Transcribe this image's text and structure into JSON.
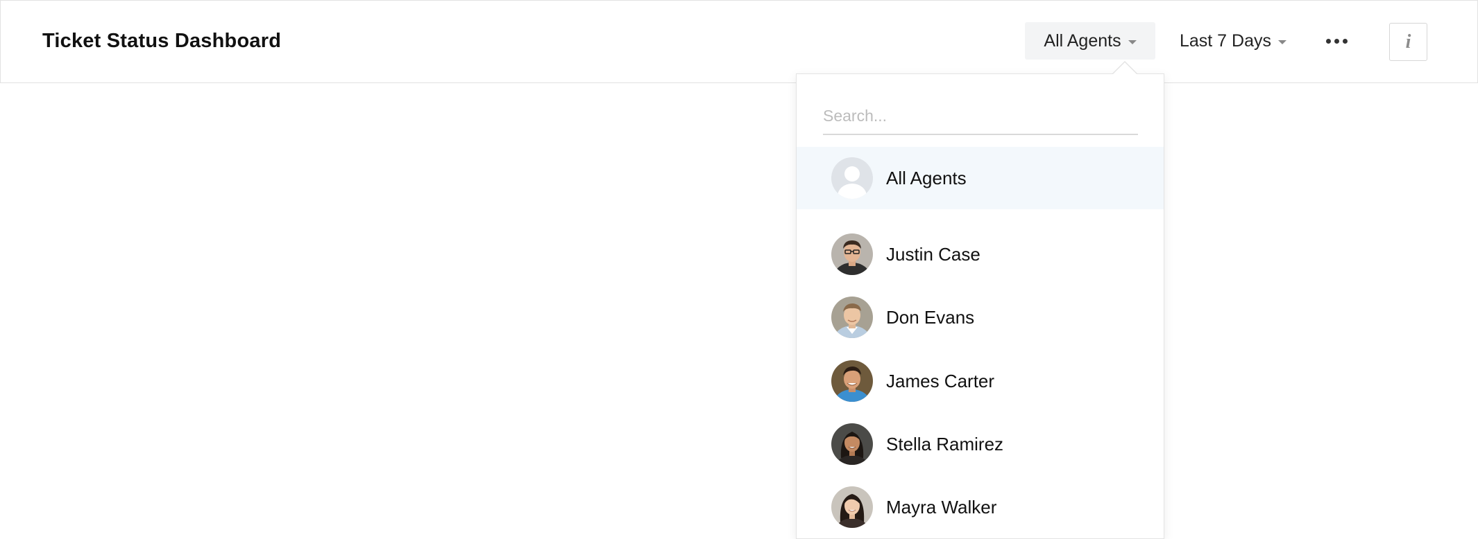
{
  "header": {
    "title": "Ticket Status Dashboard",
    "agent_filter": "All Agents",
    "date_filter": "Last 7 Days",
    "more_icon": "ellipsis-icon",
    "info_icon": "info-icon",
    "info_glyph": "i"
  },
  "agent_dropdown": {
    "search_placeholder": "Search...",
    "options": [
      {
        "label": "All Agents",
        "selected": true,
        "avatar": "default-avatar-icon"
      },
      {
        "label": "Justin Case",
        "selected": false,
        "avatar": "agent-photo"
      },
      {
        "label": "Don Evans",
        "selected": false,
        "avatar": "agent-photo"
      },
      {
        "label": "James Carter",
        "selected": false,
        "avatar": "agent-photo"
      },
      {
        "label": "Stella Ramirez",
        "selected": false,
        "avatar": "agent-photo"
      },
      {
        "label": "Mayra Walker",
        "selected": false,
        "avatar": "agent-photo"
      }
    ]
  },
  "colors": {
    "selected_bg": "#f3f8fc",
    "filter_bg": "#f3f4f5",
    "border": "#e2e2e2"
  }
}
